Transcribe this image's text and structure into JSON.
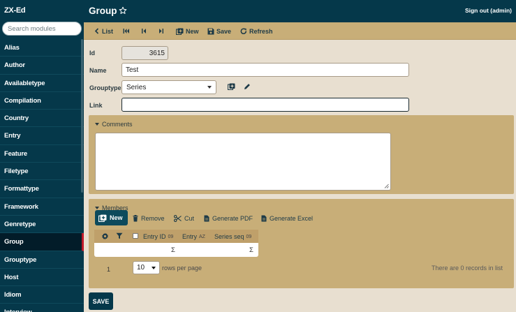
{
  "app": {
    "brand": "ZX-Ed"
  },
  "sidebar": {
    "search_placeholder": "Search modules",
    "items": [
      {
        "label": "Alias"
      },
      {
        "label": "Author"
      },
      {
        "label": "Availabletype"
      },
      {
        "label": "Compilation"
      },
      {
        "label": "Country"
      },
      {
        "label": "Entry"
      },
      {
        "label": "Feature"
      },
      {
        "label": "Filetype"
      },
      {
        "label": "Formattype"
      },
      {
        "label": "Framework"
      },
      {
        "label": "Genretype"
      },
      {
        "label": "Group",
        "active": true
      },
      {
        "label": "Grouptype"
      },
      {
        "label": "Host"
      },
      {
        "label": "Idiom"
      },
      {
        "label": "Interview"
      }
    ]
  },
  "header": {
    "title": "Group",
    "signout": "Sign out (admin)"
  },
  "toolbar": {
    "list": "List",
    "new": "New",
    "save": "Save",
    "refresh": "Refresh"
  },
  "form": {
    "id_label": "Id",
    "id_value": "3615",
    "name_label": "Name",
    "name_value": "Test",
    "grouptype_label": "Grouptype",
    "grouptype_value": "Series",
    "link_label": "Link",
    "link_value": ""
  },
  "comments": {
    "title": "Comments",
    "value": ""
  },
  "members": {
    "title": "Members",
    "new": "New",
    "remove": "Remove",
    "cut": "Cut",
    "pdf": "Generate PDF",
    "excel": "Generate Excel",
    "columns": {
      "entry_id": "Entry ID",
      "entry_id_sort": "09",
      "entry": "Entry",
      "entry_sort": "AZ",
      "series_seq": "Series seq",
      "series_seq_sort": "09"
    },
    "sum_symbol": "Σ",
    "page": "1",
    "rows_per_page": "10",
    "rows_label": "rows per page",
    "records": "There are 0 records in list"
  },
  "footer": {
    "save": "SAVE"
  },
  "colors": {
    "nav": "#05384a",
    "panel": "#c8ae78",
    "bg": "#e8dfd0",
    "accent": "#c0192b"
  }
}
